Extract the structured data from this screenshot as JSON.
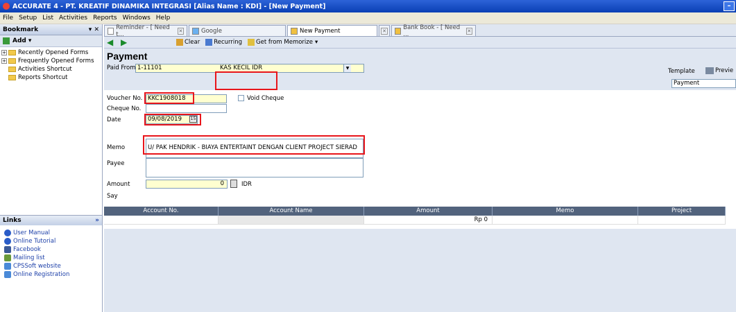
{
  "window": {
    "title": "ACCURATE 4 - PT. KREATIF DINAMIKA INTEGRASI  [Alias Name : KDI] - [New Payment]"
  },
  "menu": [
    "File",
    "Setup",
    "List",
    "Activities",
    "Reports",
    "Windows",
    "Help"
  ],
  "bookmark": {
    "title": "Bookmark",
    "add_label": "Add",
    "items": [
      {
        "label": "Recently Opened Forms",
        "expandable": true
      },
      {
        "label": "Frequently Opened Forms",
        "expandable": true
      },
      {
        "label": "Activities Shortcut",
        "expandable": false
      },
      {
        "label": "Reports Shortcut",
        "expandable": false
      }
    ]
  },
  "links": {
    "title": "Links",
    "items": [
      "User Manual",
      "Online Tutorial",
      "Facebook",
      "Mailing list",
      "CPSSoft website",
      "Online Registration"
    ]
  },
  "tabs": [
    {
      "label": "Reminder - [ Need t...",
      "active": false
    },
    {
      "label": "Google",
      "active": false
    },
    {
      "label": "New Payment",
      "active": true
    },
    {
      "label": "Bank Book - [ Need ...",
      "active": false
    }
  ],
  "toolbar": {
    "clear": "Clear",
    "recurring": "Recurring",
    "memorize": "Get from Memorize"
  },
  "form": {
    "heading": "Payment",
    "paid_from_label": "Paid From",
    "paid_from_code": "1-11101",
    "paid_from_name": "KAS KECIL IDR",
    "voucher_label": "Voucher No.",
    "voucher_value": "KKC1908018",
    "void_cheque_label": "Void Cheque",
    "cheque_label": "Cheque No.",
    "cheque_value": "",
    "date_label": "Date",
    "date_value": "09/08/2019",
    "memo_label": "Memo",
    "memo_value": "U/ PAK HENDRIK - BIAYA ENTERTAINT DENGAN CLIENT PROJECT SIERAD",
    "payee_label": "Payee",
    "payee_value": "",
    "amount_label": "Amount",
    "amount_value": "0",
    "currency": "IDR",
    "say_label": "Say",
    "template_label": "Template",
    "template_value": "Payment",
    "preview_label": "Previe"
  },
  "grid": {
    "columns": [
      "Account No.",
      "Account Name",
      "Amount",
      "Memo",
      "Project"
    ],
    "total": "Rp 0"
  },
  "colors": {
    "highlight": "#e8151b",
    "panel": "#dfe6f1",
    "grid_header": "#52637d"
  }
}
